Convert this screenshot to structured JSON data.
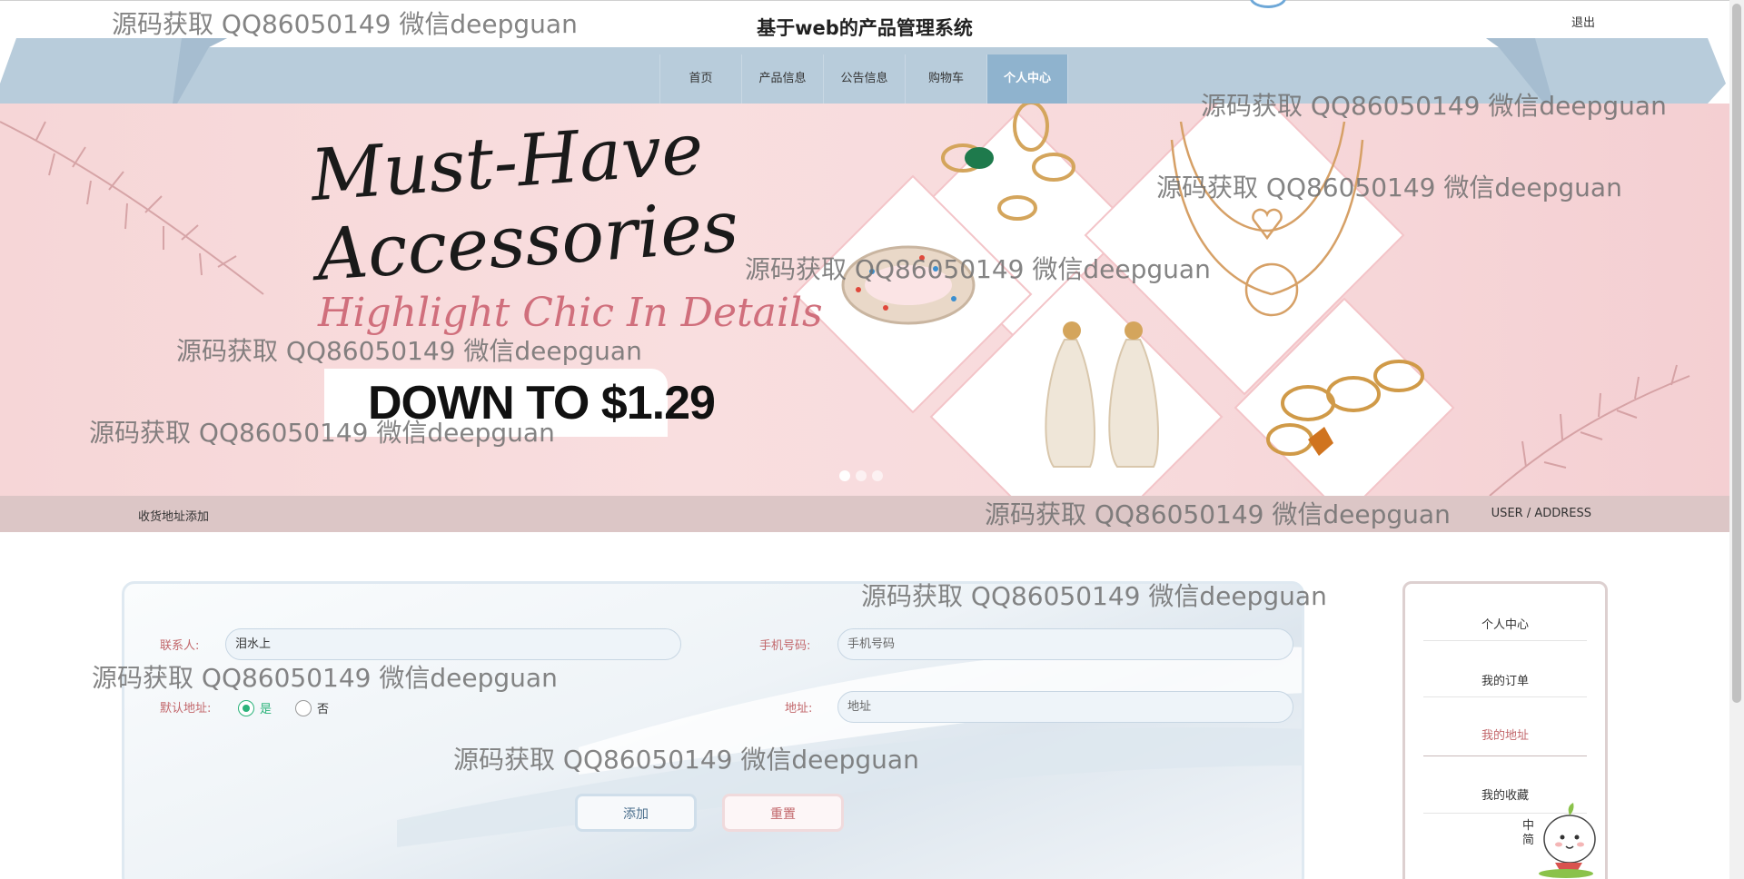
{
  "header": {
    "title": "基于web的产品管理系统",
    "logout": "退出"
  },
  "nav": {
    "items": [
      {
        "label": "首页"
      },
      {
        "label": "产品信息"
      },
      {
        "label": "公告信息"
      },
      {
        "label": "购物车"
      },
      {
        "label": "个人中心"
      }
    ],
    "active": "个人中心"
  },
  "banner": {
    "headline_line1": "Must-Have",
    "headline_line2": "Accessories",
    "tagline": "Highlight Chic In Details",
    "price_text": "DOWN TO $1.29",
    "slides": 3,
    "active_slide": 1
  },
  "breadcrumb": {
    "left": "收货地址添加",
    "right": "USER / ADDRESS"
  },
  "form": {
    "contact_label": "联系人:",
    "contact_value": "泪水上",
    "phone_label": "手机号码:",
    "phone_placeholder": "手机号码",
    "default_label": "默认地址:",
    "radio_yes": "是",
    "radio_no": "否",
    "default_selected": "是",
    "address_label": "地址:",
    "address_placeholder": "地址",
    "add_button": "添加",
    "reset_button": "重置"
  },
  "side_menu": {
    "items": [
      {
        "label": "个人中心"
      },
      {
        "label": "我的订单"
      },
      {
        "label": "我的地址"
      },
      {
        "label": "我的收藏"
      }
    ],
    "active": "我的地址"
  },
  "mascot": {
    "text": "中 简"
  },
  "watermark": {
    "text": "源码获取 QQ86050149 微信deepguan"
  },
  "colors": {
    "nav_band": "#b8ccdb",
    "nav_active": "#8fb3ce",
    "banner_bg": "#f7d9db",
    "breadcrumb_bg": "#dcc6c6",
    "label_red": "#c2676b",
    "radio_green": "#2bb37a"
  }
}
